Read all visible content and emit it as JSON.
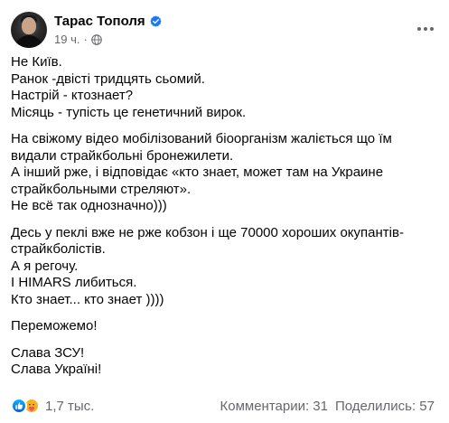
{
  "post": {
    "author": "Тарас Тополя",
    "time": "19 ч.",
    "dot": "·",
    "paragraphs": [
      [
        "Не Київ.",
        "Ранок -двісті тридцять сьомий.",
        "Настрій - ктознает?",
        "Місяць - тупість це генетичний вирок."
      ],
      [
        "На свіжому відео мобілізований біоорганізм жаліється що їм",
        "видали страйкбольні бронежилети.",
        "А інший рже, і відповідає «кто знает, может там на Украине",
        "страйкбольными стреляют».",
        "Не всё так однозначно)))"
      ],
      [
        "Десь у пеклі вже не рже кобзон і ще 70000 хороших окупантів-",
        "страйкболістів.",
        "А я регочу.",
        "І HIMARS либиться.",
        "Кто знает... кто знает ))))"
      ],
      [
        "Переможемо!"
      ],
      [
        "Слава ЗСУ!",
        "Слава Україні!"
      ]
    ]
  },
  "footer": {
    "reaction_count": "1,7 тыс.",
    "comments": "Комментарии: 31",
    "shares": "Поделились: 57"
  },
  "colors": {
    "text": "#050505",
    "secondary": "#65676b",
    "verified": "#1877f2",
    "like": "#1877f2",
    "care": "#f7b125"
  },
  "icons": {
    "verified": "verified-badge-icon",
    "audience": "globe-icon",
    "menu": "more-options-icon",
    "reaction_like": "like-reaction-icon",
    "reaction_care": "care-reaction-icon"
  }
}
